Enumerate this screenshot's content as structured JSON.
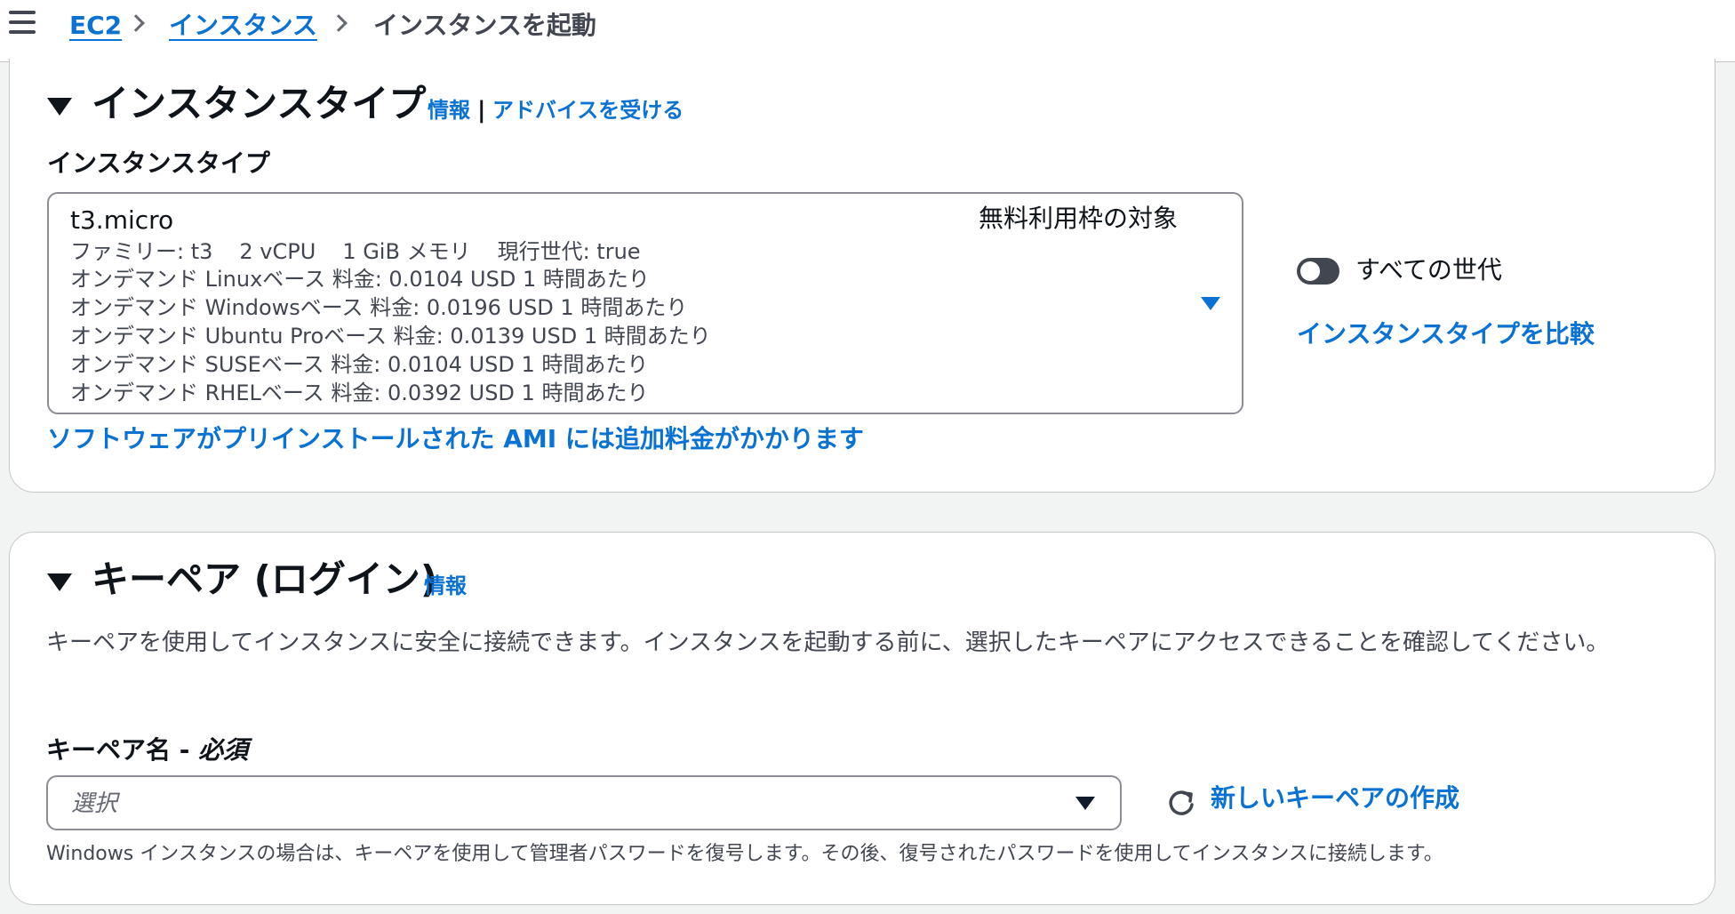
{
  "breadcrumb": {
    "items": [
      "EC2",
      "インスタンス"
    ],
    "current": "インスタンスを起動"
  },
  "instance_type_section": {
    "title": "インスタンスタイプ",
    "info_link": "情報",
    "separator": "|",
    "advice_link": "アドバイスを受ける",
    "field_label": "インスタンスタイプ",
    "selected": {
      "name": "t3.micro",
      "free_tier": "無料利用枠の対象",
      "family": "ファミリー: t3",
      "vcpu": "2 vCPU",
      "memory": "1 GiB メモリ",
      "current_gen": "現行世代: true",
      "prices": [
        "オンデマンド Linuxベース 料金: 0.0104 USD 1 時間あたり",
        "オンデマンド Windowsベース 料金: 0.0196 USD 1 時間あたり",
        "オンデマンド Ubuntu Proベース 料金: 0.0139 USD 1 時間あたり",
        "オンデマンド SUSEベース 料金: 0.0104 USD 1 時間あたり",
        "オンデマンド RHELベース 料金: 0.0392 USD 1 時間あたり"
      ]
    },
    "all_generations_label": "すべての世代",
    "all_generations_on": false,
    "compare_link": "インスタンスタイプを比較",
    "ami_notice_link": "ソフトウェアがプリインストールされた AMI には追加料金がかかります"
  },
  "key_pair_section": {
    "title": "キーペア (ログイン)",
    "info_link": "情報",
    "description": "キーペアを使用してインスタンスに安全に接続できます。インスタンスを起動する前に、選択したキーペアにアクセスできることを確認してください。",
    "field_label": "キーペア名 - ",
    "required": "必須",
    "placeholder": "選択",
    "create_link": "新しいキーペアの作成",
    "hint": "Windows インスタンスの場合は、キーペアを使用して管理者パスワードを復号します。その後、復号されたパスワードを使用してインスタンスに接続します。"
  },
  "colors": {
    "link": "#0972d3",
    "text": "#0f141a",
    "secondary_text": "#424650",
    "border": "#8c8c94"
  }
}
